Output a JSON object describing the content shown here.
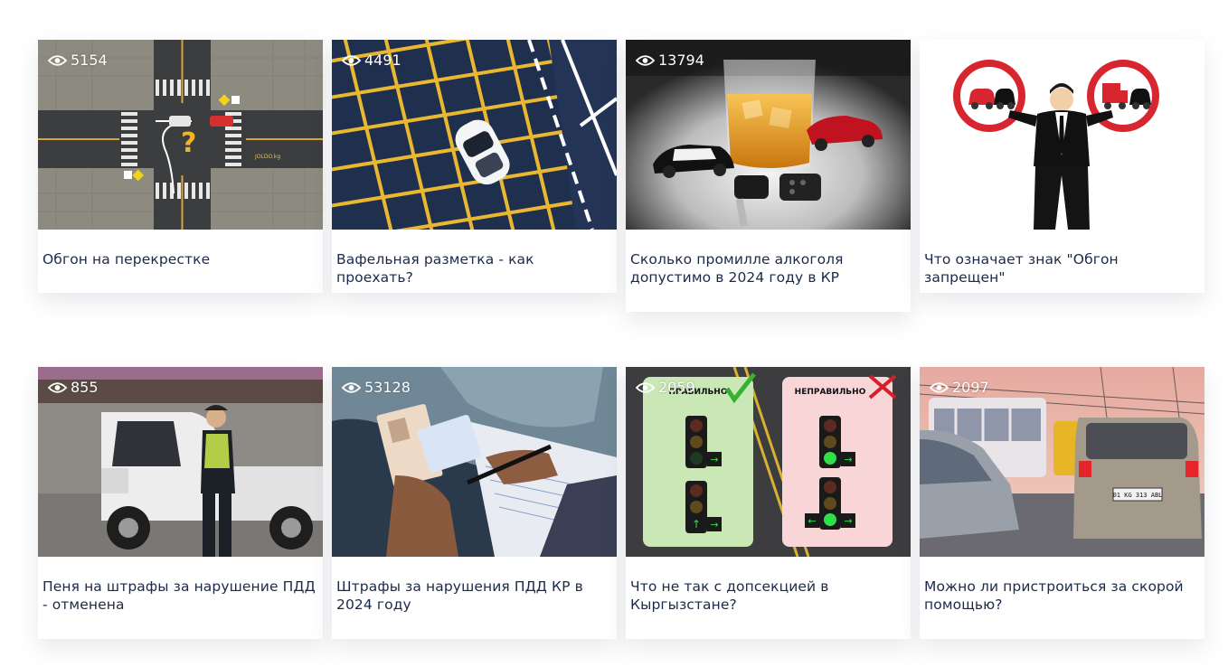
{
  "cards": [
    {
      "views": "5154",
      "title": "Обгон на перекрестке"
    },
    {
      "views": "4491",
      "title": "Вафельная разметка - как проехать?"
    },
    {
      "views": "13794",
      "title": "Сколько промилле алкоголя допустимо в 2024 году в КР"
    },
    {
      "views": "",
      "title": "Что означает знак \"Обгон запрещен\""
    },
    {
      "views": "855",
      "title": "Пеня на штрафы за нарушение ПДД - отменена"
    },
    {
      "views": "53128",
      "title": "Штрафы за нарушения ПДД КР в 2024 году"
    },
    {
      "views": "2059",
      "title": "Что не так с допсекцией в Кыргызстане?"
    },
    {
      "views": "2097",
      "title": "Можно ли пристроиться за скорой помощью?"
    }
  ],
  "image_text": {
    "watermark": "JOLDO.kg",
    "correct": "ПРАВИЛЬНО",
    "incorrect": "НЕПРАВИЛЬНО",
    "plate": "01 KG 313 ABL"
  }
}
